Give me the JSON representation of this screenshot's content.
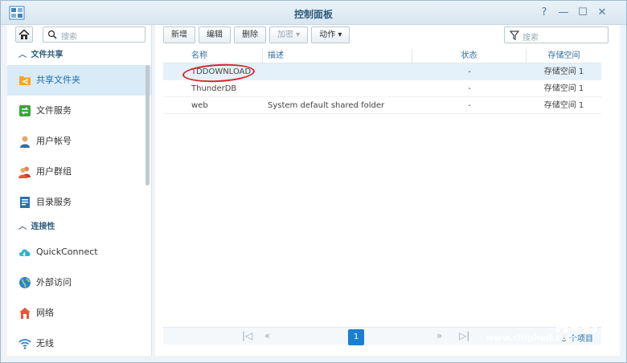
{
  "window": {
    "title": "控制面板",
    "controls": [
      "?",
      "—",
      "☐",
      "✕"
    ]
  },
  "sidebar": {
    "search_placeholder": "搜索",
    "sections": [
      {
        "title": "文件共享",
        "items": [
          {
            "label": "共享文件夹",
            "icon": "shared-folder-icon",
            "active": true
          },
          {
            "label": "文件服务",
            "icon": "file-service-icon"
          },
          {
            "label": "用户帐号",
            "icon": "user-icon"
          },
          {
            "label": "用户群组",
            "icon": "group-icon"
          },
          {
            "label": "目录服务",
            "icon": "directory-icon"
          }
        ]
      },
      {
        "title": "连接性",
        "items": [
          {
            "label": "QuickConnect",
            "icon": "cloud-icon"
          },
          {
            "label": "外部访问",
            "icon": "globe-icon"
          },
          {
            "label": "网络",
            "icon": "network-icon"
          },
          {
            "label": "无线",
            "icon": "wifi-icon"
          }
        ]
      }
    ]
  },
  "toolbar": {
    "create": "新增",
    "edit": "编辑",
    "delete": "删除",
    "encrypt": "加密 ▾",
    "action": "动作 ▾",
    "filter_placeholder": "搜索"
  },
  "table": {
    "columns": [
      "名称",
      "描述",
      "状态",
      "存储空间"
    ],
    "rows": [
      {
        "name": "TDDOWNLOAD",
        "desc": "",
        "status": "-",
        "volume": "存储空间 1"
      },
      {
        "name": "ThunderDB",
        "desc": "",
        "status": "-",
        "volume": "存储空间 1"
      },
      {
        "name": "web",
        "desc": "System default shared folder",
        "status": "-",
        "volume": "存储空间 1"
      }
    ]
  },
  "pager": {
    "current": "1",
    "count": "3 个项目"
  },
  "watermark": {
    "url": "www.chiphell.com"
  },
  "colors": {
    "accent": "#1a7fd1",
    "selected_row": "#e4f1fb",
    "highlight": "#d22222"
  }
}
